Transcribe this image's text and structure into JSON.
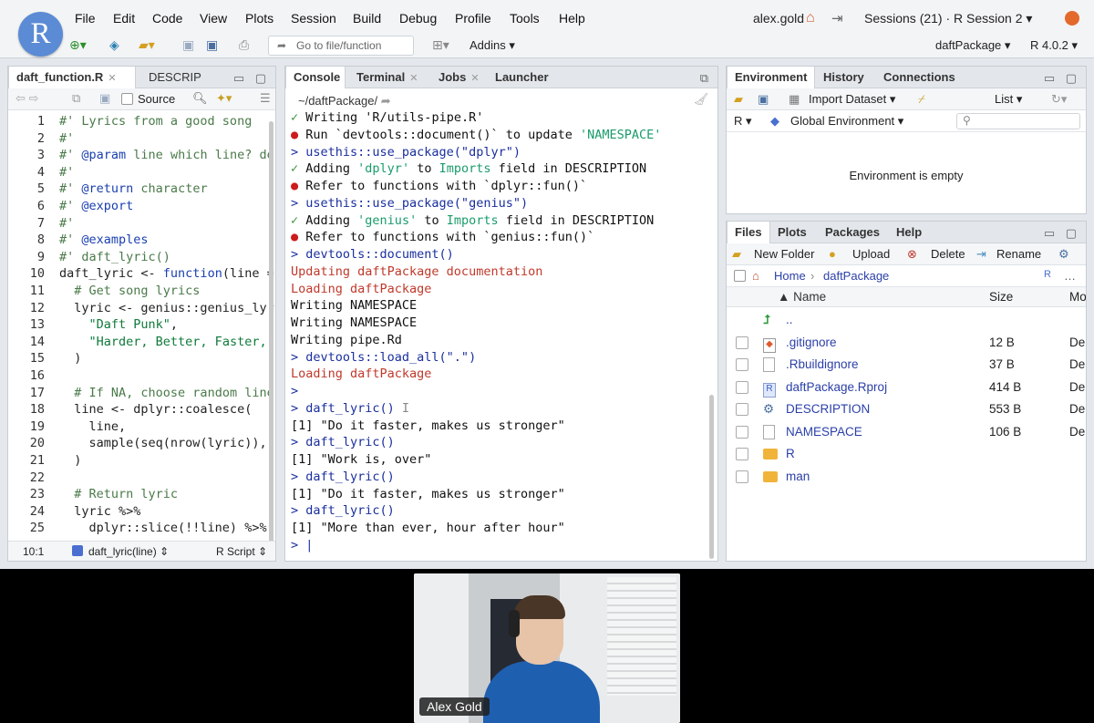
{
  "menu": {
    "items": [
      "File",
      "Edit",
      "Code",
      "View",
      "Plots",
      "Session",
      "Build",
      "Debug",
      "Profile",
      "Tools",
      "Help"
    ],
    "user": "alex.gold",
    "sessions": "Sessions (21) · R Session 2 ▾"
  },
  "toolbar": {
    "goto_placeholder": "Go to file/function",
    "addins": "Addins ▾",
    "project": "daftPackage ▾",
    "r_version": "R 4.0.2 ▾"
  },
  "editor": {
    "tabs": [
      "daft_function.R",
      "DESCRIP"
    ],
    "source_label": "Source",
    "lines": [
      {
        "n": "1",
        "html": "<span class='cmt'>#' Lyrics from a good song</span>"
      },
      {
        "n": "2",
        "html": "<span class='cmt'>#'</span>"
      },
      {
        "n": "3",
        "html": "<span class='cmt'>#' <span class='kw'>@param</span> line which line? de</span>"
      },
      {
        "n": "4",
        "html": "<span class='cmt'>#'</span>"
      },
      {
        "n": "5",
        "html": "<span class='cmt'>#' <span class='kw'>@return</span> character</span>"
      },
      {
        "n": "6",
        "html": "<span class='cmt'>#' <span class='kw'>@export</span></span>"
      },
      {
        "n": "7",
        "html": "<span class='cmt'>#'</span>"
      },
      {
        "n": "8",
        "html": "<span class='cmt'>#' <span class='kw'>@examples</span></span>"
      },
      {
        "n": "9",
        "html": "<span class='cmt'>#' daft_lyric()</span>"
      },
      {
        "n": "10",
        "html": "daft_lyric <- <span class='kw'>function</span>(line ="
      },
      {
        "n": "11",
        "html": "  <span class='cmt'># Get song lyrics</span>"
      },
      {
        "n": "12",
        "html": "  lyric <- genius::genius_lyr"
      },
      {
        "n": "13",
        "html": "    <span class='str'>\"Daft Punk\"</span>,"
      },
      {
        "n": "14",
        "html": "    <span class='str'>\"Harder, Better, Faster,</span>"
      },
      {
        "n": "15",
        "html": "  )"
      },
      {
        "n": "16",
        "html": ""
      },
      {
        "n": "17",
        "html": "  <span class='cmt'># If NA, choose random line</span>"
      },
      {
        "n": "18",
        "html": "  line <- dplyr::coalesce("
      },
      {
        "n": "19",
        "html": "    line,"
      },
      {
        "n": "20",
        "html": "    sample(seq(nrow(lyric)),"
      },
      {
        "n": "21",
        "html": "  )"
      },
      {
        "n": "22",
        "html": ""
      },
      {
        "n": "23",
        "html": "  <span class='cmt'># Return lyric</span>"
      },
      {
        "n": "24",
        "html": "  lyric %>%"
      },
      {
        "n": "25",
        "html": "    dplyr::slice(!!line) %>%"
      },
      {
        "n": "26",
        "html": ""
      }
    ],
    "status_pos": "10:1",
    "status_fn": "daft_lyric(line) ⇕",
    "status_type": "R Script ⇕"
  },
  "console": {
    "tabs": [
      "Console",
      "Terminal",
      "Jobs",
      "Launcher"
    ],
    "path": "~/daftPackage/",
    "lines": [
      {
        "cls": "out",
        "html": "<span class='tick'>✓</span> Writing 'R/utils-pipe.R'"
      },
      {
        "cls": "out",
        "html": "<span class='dot'>●</span> Run `devtools::document()` to update <span class='hl'>'NAMESPACE'</span>"
      },
      {
        "cls": "cmd",
        "html": "> usethis::use_package(\"dplyr\")"
      },
      {
        "cls": "out",
        "html": "<span class='tick'>✓</span> Adding <span class='hl'>'dplyr'</span> to <span class='hl'>Imports</span> field in DESCRIPTION"
      },
      {
        "cls": "out",
        "html": "<span class='dot'>●</span> Refer to functions with `dplyr::fun()`"
      },
      {
        "cls": "cmd",
        "html": "> usethis::use_package(\"genius\")"
      },
      {
        "cls": "out",
        "html": "<span class='tick'>✓</span> Adding <span class='hl'>'genius'</span> to <span class='hl'>Imports</span> field in DESCRIPTION"
      },
      {
        "cls": "out",
        "html": "<span class='dot'>●</span> Refer to functions with `genius::fun()`"
      },
      {
        "cls": "cmd",
        "html": "> devtools::document()"
      },
      {
        "cls": "err",
        "html": "Updating daftPackage documentation"
      },
      {
        "cls": "err",
        "html": "Loading daftPackage"
      },
      {
        "cls": "out",
        "html": "Writing NAMESPACE"
      },
      {
        "cls": "out",
        "html": "Writing NAMESPACE"
      },
      {
        "cls": "out",
        "html": "Writing pipe.Rd"
      },
      {
        "cls": "cmd",
        "html": "> devtools::load_all(\".\")"
      },
      {
        "cls": "err",
        "html": "Loading daftPackage"
      },
      {
        "cls": "cmd",
        "html": ">"
      },
      {
        "cls": "cmd",
        "html": "> daft_lyric() <span style='color:#888'>I</span>"
      },
      {
        "cls": "out",
        "html": "[1] \"Do it faster, makes us stronger\""
      },
      {
        "cls": "cmd",
        "html": "> daft_lyric()"
      },
      {
        "cls": "out",
        "html": "[1] \"Work is, over\""
      },
      {
        "cls": "cmd",
        "html": "> daft_lyric()"
      },
      {
        "cls": "out",
        "html": "[1] \"Do it faster, makes us stronger\""
      },
      {
        "cls": "cmd",
        "html": "> daft_lyric()"
      },
      {
        "cls": "out",
        "html": "[1] \"More than ever, hour after hour\""
      },
      {
        "cls": "cmd",
        "html": "> |"
      }
    ]
  },
  "environment": {
    "tabs": [
      "Environment",
      "History",
      "Connections"
    ],
    "import_label": "Import Dataset ▾",
    "list_label": "List ▾",
    "lang": "R ▾",
    "scope": "Global Environment ▾",
    "empty_msg": "Environment is empty"
  },
  "files": {
    "tabs": [
      "Files",
      "Plots",
      "Packages",
      "Help"
    ],
    "actions": [
      "New Folder",
      "Upload",
      "Delete",
      "Rename"
    ],
    "crumb_home": "Home",
    "crumb_dir": "daftPackage",
    "col_name": "▲ Name",
    "col_size": "Size",
    "col_mod": "Mo",
    "rows": [
      {
        "name": "..",
        "size": "",
        "mod": "",
        "icon": "up"
      },
      {
        "name": ".gitignore",
        "size": "12 B",
        "mod": "De",
        "icon": "git"
      },
      {
        "name": ".Rbuildignore",
        "size": "37 B",
        "mod": "De",
        "icon": "doc"
      },
      {
        "name": "daftPackage.Rproj",
        "size": "414 B",
        "mod": "De",
        "icon": "rproj"
      },
      {
        "name": "DESCRIPTION",
        "size": "553 B",
        "mod": "De",
        "icon": "gear"
      },
      {
        "name": "NAMESPACE",
        "size": "106 B",
        "mod": "De",
        "icon": "doc"
      },
      {
        "name": "R",
        "size": "",
        "mod": "",
        "icon": "folder"
      },
      {
        "name": "man",
        "size": "",
        "mod": "",
        "icon": "folder"
      }
    ]
  },
  "video": {
    "name": "Alex Gold"
  }
}
